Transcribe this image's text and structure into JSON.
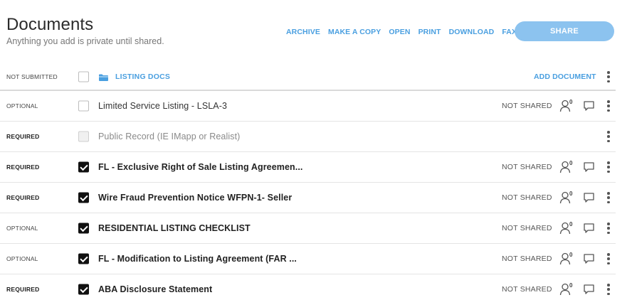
{
  "header": {
    "title": "Documents",
    "subtitle": "Anything you add is private until shared."
  },
  "actions": [
    "ARCHIVE",
    "MAKE A COPY",
    "OPEN",
    "PRINT",
    "DOWNLOAD",
    "FAX"
  ],
  "share_label": "SHARE",
  "folder": {
    "status": "NOT SUBMITTED",
    "label": "LISTING DOCS",
    "add_label": "ADD DOCUMENT"
  },
  "documents": [
    {
      "status": "OPTIONAL",
      "name": "Limited Service Listing - LSLA-3",
      "shared": "NOT SHARED",
      "count": "0",
      "checked": false
    },
    {
      "status": "REQUIRED",
      "name": "Public Record (IE IMapp or Realist)",
      "shared": "",
      "count": "",
      "checked": false
    },
    {
      "status": "REQUIRED",
      "name": "FL - Exclusive Right of Sale Listing Agreemen...",
      "shared": "NOT SHARED",
      "count": "0",
      "checked": true
    },
    {
      "status": "REQUIRED",
      "name": "Wire Fraud Prevention Notice WFPN-1- Seller",
      "shared": "NOT SHARED",
      "count": "0",
      "checked": true
    },
    {
      "status": "OPTIONAL",
      "name": "RESIDENTIAL LISTING CHECKLIST",
      "shared": "NOT SHARED",
      "count": "0",
      "checked": true
    },
    {
      "status": "OPTIONAL",
      "name": "FL - Modification to Listing Agreement (FAR ...",
      "shared": "NOT SHARED",
      "count": "0",
      "checked": true
    },
    {
      "status": "REQUIRED",
      "name": "ABA Disclosure Statement",
      "shared": "NOT SHARED",
      "count": "0",
      "checked": true
    }
  ],
  "colors": {
    "accent": "#4a9fe0",
    "share_button": "#8cc3ef"
  }
}
